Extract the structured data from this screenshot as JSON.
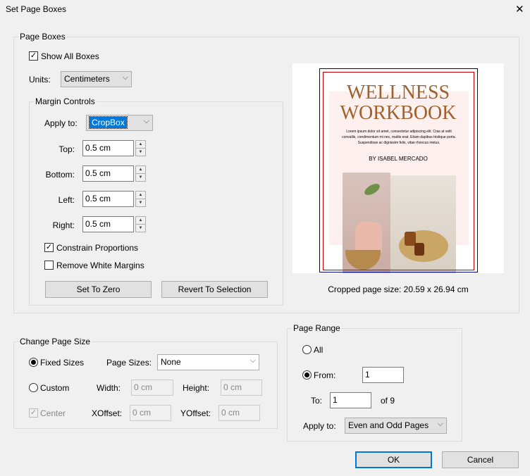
{
  "window": {
    "title": "Set Page Boxes",
    "close": "✕"
  },
  "page_boxes": {
    "legend": "Page Boxes",
    "show_all": "Show All Boxes",
    "show_all_checked": true,
    "units_label": "Units:",
    "units_value": "Centimeters",
    "margin_controls": {
      "legend": "Margin Controls",
      "apply_to_label": "Apply to:",
      "apply_to_value": "CropBox",
      "top_label": "Top:",
      "top_value": "0.5 cm",
      "bottom_label": "Bottom:",
      "bottom_value": "0.5 cm",
      "left_label": "Left:",
      "left_value": "0.5 cm",
      "right_label": "Right:",
      "right_value": "0.5 cm",
      "constrain": "Constrain Proportions",
      "constrain_checked": true,
      "remove_white": "Remove White Margins",
      "remove_white_checked": false,
      "set_zero": "Set To Zero",
      "revert": "Revert To Selection"
    }
  },
  "preview": {
    "title1": "WELLNESS",
    "title2": "WORKBOOK",
    "body": "Lorem ipsum dolor sit amet, consectetur adipiscing elit. Cras at velit convallis, condimentum mi nec, mattis erat. Etiam dapibus tristique porta. Suspendisse ac dignissim felis, vitae rhoncus metus.",
    "author": "BY ISABEL MERCADO",
    "cropped_size": "Cropped page size: 20.59 x 26.94 cm",
    "colors": {
      "mediabox": "#000080",
      "cropbox": "#c00000",
      "title": "#a0612f"
    }
  },
  "change_page_size": {
    "legend": "Change Page Size",
    "fixed": "Fixed Sizes",
    "fixed_selected": true,
    "page_sizes_label": "Page Sizes:",
    "page_sizes_value": "None",
    "custom": "Custom",
    "width_label": "Width:",
    "width_value": "0 cm",
    "height_label": "Height:",
    "height_value": "0 cm",
    "center": "Center",
    "xoffset_label": "XOffset:",
    "xoffset_value": "0 cm",
    "yoffset_label": "YOffset:",
    "yoffset_value": "0 cm"
  },
  "page_range": {
    "legend": "Page Range",
    "all": "All",
    "from": "From:",
    "from_selected": true,
    "from_value": "1",
    "to_label": "To:",
    "to_value": "1",
    "of": "of 9",
    "apply_to_label": "Apply to:",
    "apply_to_value": "Even and Odd Pages"
  },
  "buttons": {
    "ok": "OK",
    "cancel": "Cancel"
  }
}
